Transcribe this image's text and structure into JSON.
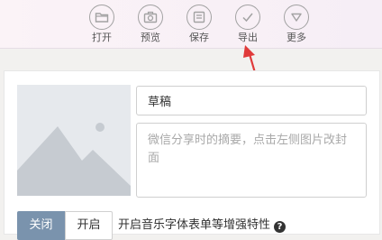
{
  "toolbar": {
    "items": [
      {
        "label": "打开",
        "icon": "folder-icon"
      },
      {
        "label": "预览",
        "icon": "camera-icon"
      },
      {
        "label": "保存",
        "icon": "save-icon"
      },
      {
        "label": "导出",
        "icon": "check-icon"
      },
      {
        "label": "更多",
        "icon": "chevron-down-icon"
      }
    ]
  },
  "editor": {
    "title_value": "草稿",
    "description_placeholder": "微信分享时的摘要，点击左侧图片改封面",
    "toggle": {
      "off_label": "关闭",
      "on_label": "开启"
    },
    "feature_label": "开启音乐字体表单等增强特性",
    "help_symbol": "?"
  },
  "colors": {
    "arrow": "#e03a3a",
    "toggle_active": "#7a93ad",
    "icon_stroke": "#a2a2a2"
  }
}
